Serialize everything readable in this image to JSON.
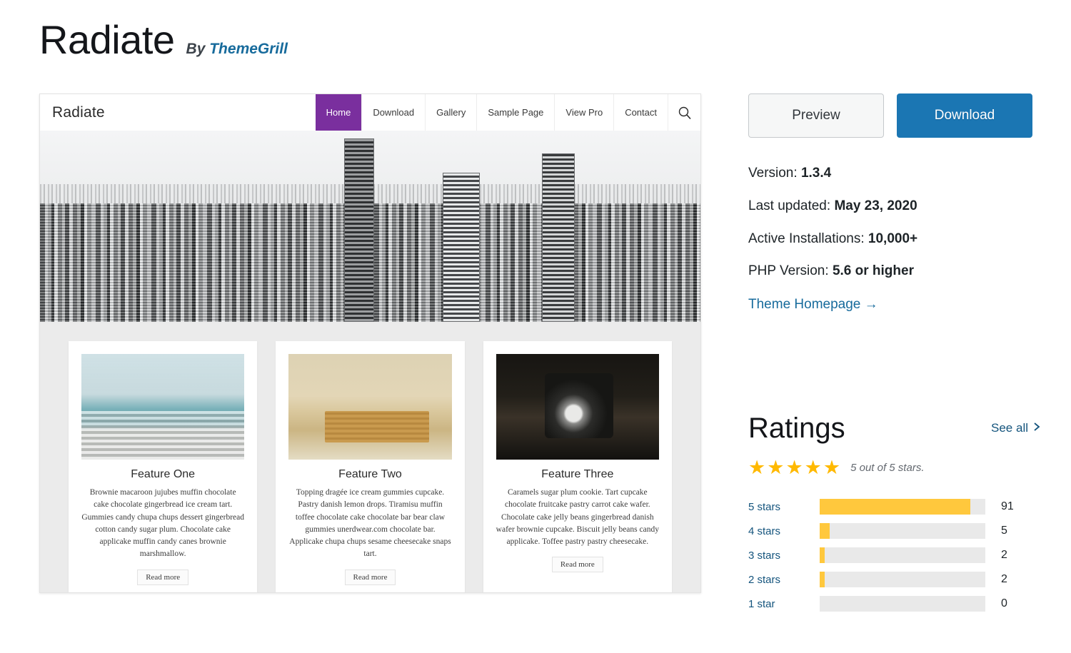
{
  "header": {
    "title": "Radiate",
    "by_label": "By",
    "author": "ThemeGrill"
  },
  "preview": {
    "site_brand": "Radiate",
    "nav_items": [
      {
        "label": "Home",
        "active": true
      },
      {
        "label": "Download",
        "active": false
      },
      {
        "label": "Gallery",
        "active": false
      },
      {
        "label": "Sample Page",
        "active": false
      },
      {
        "label": "View Pro",
        "active": false
      },
      {
        "label": "Contact",
        "active": false
      }
    ],
    "search_icon": "search-icon",
    "hero_alt": "black and white city skyline",
    "features": [
      {
        "title": "Feature One",
        "text": "Brownie macaroon jujubes muffin chocolate cake chocolate gingerbread ice cream tart. Gummies candy chupa chups dessert gingerbread cotton candy sugar plum. Chocolate cake applicake muffin candy canes brownie marshmallow.",
        "button": "Read more"
      },
      {
        "title": "Feature Two",
        "text": "Topping dragée ice cream gummies cupcake. Pastry danish lemon drops. Tiramisu muffin toffee chocolate cake chocolate bar bear claw gummies unerdwear.com chocolate bar. Applicake chupa chups sesame cheesecake snaps tart.",
        "button": "Read more"
      },
      {
        "title": "Feature Three",
        "text": "Caramels sugar plum cookie. Tart cupcake chocolate fruitcake pastry carrot cake wafer. Chocolate cake jelly beans gingerbread danish wafer brownie cupcake. Biscuit jelly beans candy applicake. Toffee pastry pastry cheesecake.",
        "button": "Read more"
      }
    ]
  },
  "sidebar": {
    "preview_button": "Preview",
    "download_button": "Download",
    "meta": [
      {
        "label": "Version:",
        "value": "1.3.4"
      },
      {
        "label": "Last updated:",
        "value": "May 23, 2020"
      },
      {
        "label": "Active Installations:",
        "value": "10,000+"
      },
      {
        "label": "PHP Version:",
        "value": "5.6 or higher"
      }
    ],
    "homepage_link": "Theme Homepage  →"
  },
  "ratings": {
    "title": "Ratings",
    "see_all": "See all",
    "see_all_icon": "chevron-right-icon",
    "star_glyph": "★",
    "filled_stars": 5,
    "summary": "5 out of 5 stars.",
    "breakdown": [
      {
        "label": "5 stars",
        "count": "91",
        "percent": 91
      },
      {
        "label": "4 stars",
        "count": "5",
        "percent": 6
      },
      {
        "label": "3 stars",
        "count": "2",
        "percent": 3
      },
      {
        "label": "2 stars",
        "count": "2",
        "percent": 3
      },
      {
        "label": "1 star",
        "count": "0",
        "percent": 0
      }
    ]
  },
  "colors": {
    "accent_blue": "#1b76b3",
    "link_blue": "#176b9c",
    "star_yellow": "#ffb900",
    "bar_yellow": "#ffc83d",
    "nav_active_purple": "#7a2f9e",
    "track_gray": "#e9e9e9"
  }
}
